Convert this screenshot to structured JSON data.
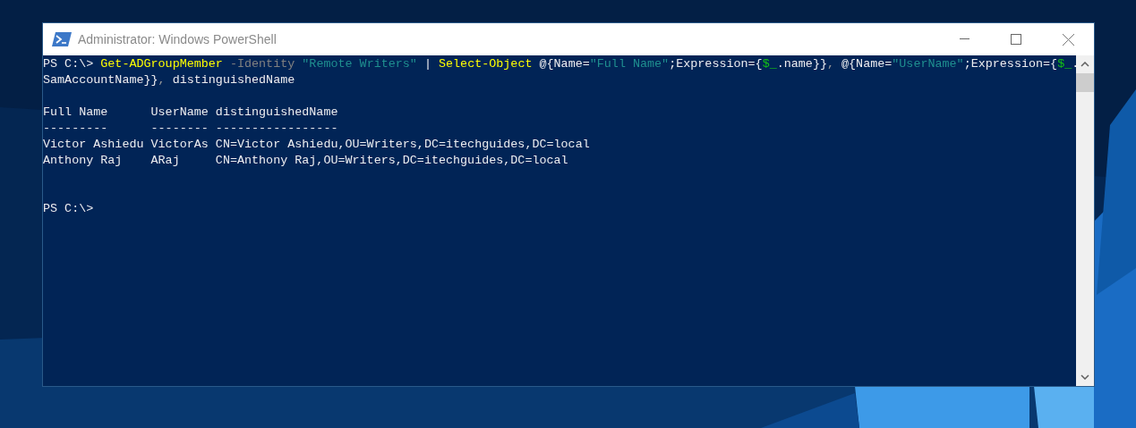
{
  "window": {
    "title": "Administrator: Windows PowerShell"
  },
  "console": {
    "lines": [
      {
        "kind": "text",
        "segments": [
          {
            "text": "PS C:\\> ",
            "kind": "plain"
          },
          {
            "text": "Get-ADGroupMember",
            "kind": "command"
          },
          {
            "text": " -Identity ",
            "kind": "parameter"
          },
          {
            "text": "\"Remote Writers\"",
            "kind": "string"
          },
          {
            "text": " | ",
            "kind": "plain"
          },
          {
            "text": "Select-Object",
            "kind": "command"
          },
          {
            "text": " @{Name=",
            "kind": "plain"
          },
          {
            "text": "\"Full Name\"",
            "kind": "string"
          },
          {
            "text": ";Expression={",
            "kind": "plain"
          },
          {
            "text": "$_",
            "kind": "variable"
          },
          {
            "text": ".name}}",
            "kind": "plain"
          },
          {
            "text": ", ",
            "kind": "operator"
          },
          {
            "text": "@{Name=",
            "kind": "plain"
          },
          {
            "text": "\"UserName\"",
            "kind": "string"
          },
          {
            "text": ";Expression={",
            "kind": "plain"
          },
          {
            "text": "$_",
            "kind": "variable"
          },
          {
            "text": ".",
            "kind": "plain"
          }
        ]
      },
      {
        "kind": "text",
        "segments": [
          {
            "text": "SamAccountName}}",
            "kind": "plain"
          },
          {
            "text": ", ",
            "kind": "operator"
          },
          {
            "text": "distinguishedName",
            "kind": "plain"
          }
        ]
      },
      {
        "kind": "blank"
      },
      {
        "kind": "text",
        "segments": [
          {
            "text": "Full Name      UserName distinguishedName",
            "kind": "plain"
          }
        ]
      },
      {
        "kind": "text",
        "segments": [
          {
            "text": "---------      -------- -----------------",
            "kind": "plain"
          }
        ]
      },
      {
        "kind": "text",
        "segments": [
          {
            "text": "Victor Ashiedu VictorAs CN=Victor Ashiedu,OU=Writers,DC=itechguides,DC=local",
            "kind": "plain"
          }
        ]
      },
      {
        "kind": "text",
        "segments": [
          {
            "text": "Anthony Raj    ARaj     CN=Anthony Raj,OU=Writers,DC=itechguides,DC=local",
            "kind": "plain"
          }
        ]
      },
      {
        "kind": "blank"
      },
      {
        "kind": "blank"
      },
      {
        "kind": "text",
        "segments": [
          {
            "text": "PS C:\\>",
            "kind": "plain"
          }
        ]
      }
    ]
  }
}
